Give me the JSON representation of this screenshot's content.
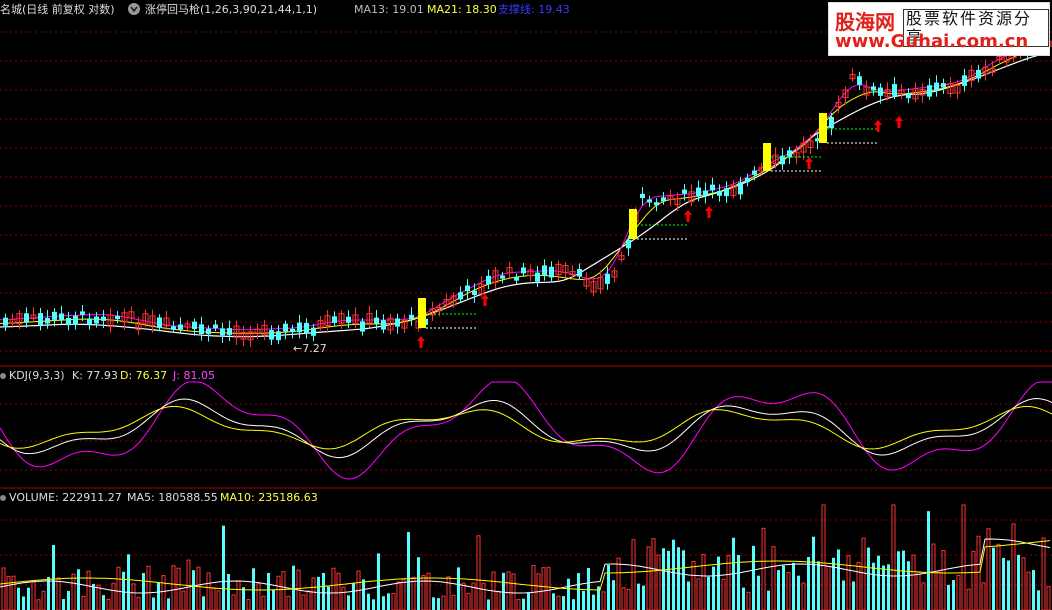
{
  "header": {
    "stock_title": "名城(日线 前复权 对数)",
    "indicator_name": "涨停回马枪(1,26,3,90,21,44,1,1)",
    "ma13_label": "MA13: 19.01",
    "ma21_label": "MA21: 18.30",
    "support_label": "支撑线: 19.43"
  },
  "kdj_panel": {
    "title": "KDJ(9,3,3)",
    "k_label": "K: 77.93",
    "d_label": "D: 76.37",
    "j_label": "J: 81.05"
  },
  "volume_panel": {
    "title": "VOLUME: 222911.27",
    "ma5_label": "MA5: 180588.55",
    "ma10_label": "MA10: 235186.63"
  },
  "annotations": {
    "low_marker": "←7.27"
  },
  "watermark": {
    "brand": "股海网",
    "tagline": "股票软件资源分享",
    "url": "www.Guhai.com.cn"
  },
  "colors": {
    "background": "#000000",
    "up_candle": "#ff3232",
    "down_candle": "#54ffff",
    "ma13": "#ffffff",
    "ma21": "#ffff00",
    "support_line": "#ff00ff",
    "limit_up_bar": "#ffff00",
    "arrow": "#ff0000",
    "grid": "#8b0000",
    "panel_border": "#b00000"
  },
  "icons": {
    "title_dropdown": "chevron-down-icon",
    "panel_marker": "circle-dot-icon"
  }
}
